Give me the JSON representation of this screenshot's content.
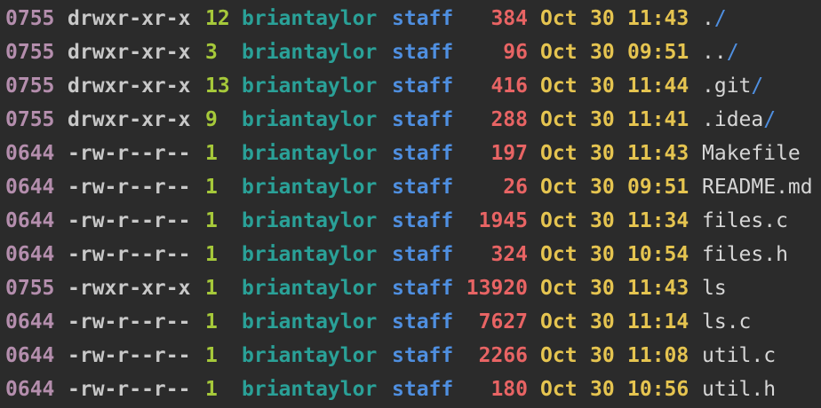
{
  "colors": {
    "background": "#2b2b2b",
    "octal": "#b48ead",
    "perms": "#c8c8c8",
    "links": "#a6c93a",
    "user": "#2aa198",
    "group": "#4f8fe0",
    "size": "#e86464",
    "date": "#e5c450",
    "name": "#d6d6d6",
    "dir_slash": "#4f8fe0"
  },
  "listing": [
    {
      "octal": "0755",
      "perms": "drwxr-xr-x",
      "links": "12",
      "user": "briantaylor",
      "group": "staff",
      "size": "384",
      "month": "Oct",
      "day": "30",
      "time": "11:43",
      "name": ".",
      "slash": "/"
    },
    {
      "octal": "0755",
      "perms": "drwxr-xr-x",
      "links": "3",
      "user": "briantaylor",
      "group": "staff",
      "size": "96",
      "month": "Oct",
      "day": "30",
      "time": "09:51",
      "name": "..",
      "slash": "/"
    },
    {
      "octal": "0755",
      "perms": "drwxr-xr-x",
      "links": "13",
      "user": "briantaylor",
      "group": "staff",
      "size": "416",
      "month": "Oct",
      "day": "30",
      "time": "11:44",
      "name": ".git",
      "slash": "/"
    },
    {
      "octal": "0755",
      "perms": "drwxr-xr-x",
      "links": "9",
      "user": "briantaylor",
      "group": "staff",
      "size": "288",
      "month": "Oct",
      "day": "30",
      "time": "11:41",
      "name": ".idea",
      "slash": "/"
    },
    {
      "octal": "0644",
      "perms": "-rw-r--r--",
      "links": "1",
      "user": "briantaylor",
      "group": "staff",
      "size": "197",
      "month": "Oct",
      "day": "30",
      "time": "11:43",
      "name": "Makefile",
      "slash": ""
    },
    {
      "octal": "0644",
      "perms": "-rw-r--r--",
      "links": "1",
      "user": "briantaylor",
      "group": "staff",
      "size": "26",
      "month": "Oct",
      "day": "30",
      "time": "09:51",
      "name": "README.md",
      "slash": ""
    },
    {
      "octal": "0644",
      "perms": "-rw-r--r--",
      "links": "1",
      "user": "briantaylor",
      "group": "staff",
      "size": "1945",
      "month": "Oct",
      "day": "30",
      "time": "11:34",
      "name": "files.c",
      "slash": ""
    },
    {
      "octal": "0644",
      "perms": "-rw-r--r--",
      "links": "1",
      "user": "briantaylor",
      "group": "staff",
      "size": "324",
      "month": "Oct",
      "day": "30",
      "time": "10:54",
      "name": "files.h",
      "slash": ""
    },
    {
      "octal": "0755",
      "perms": "-rwxr-xr-x",
      "links": "1",
      "user": "briantaylor",
      "group": "staff",
      "size": "13920",
      "month": "Oct",
      "day": "30",
      "time": "11:43",
      "name": "ls",
      "slash": ""
    },
    {
      "octal": "0644",
      "perms": "-rw-r--r--",
      "links": "1",
      "user": "briantaylor",
      "group": "staff",
      "size": "7627",
      "month": "Oct",
      "day": "30",
      "time": "11:14",
      "name": "ls.c",
      "slash": ""
    },
    {
      "octal": "0644",
      "perms": "-rw-r--r--",
      "links": "1",
      "user": "briantaylor",
      "group": "staff",
      "size": "2266",
      "month": "Oct",
      "day": "30",
      "time": "11:08",
      "name": "util.c",
      "slash": ""
    },
    {
      "octal": "0644",
      "perms": "-rw-r--r--",
      "links": "1",
      "user": "briantaylor",
      "group": "staff",
      "size": "180",
      "month": "Oct",
      "day": "30",
      "time": "10:56",
      "name": "util.h",
      "slash": ""
    }
  ]
}
